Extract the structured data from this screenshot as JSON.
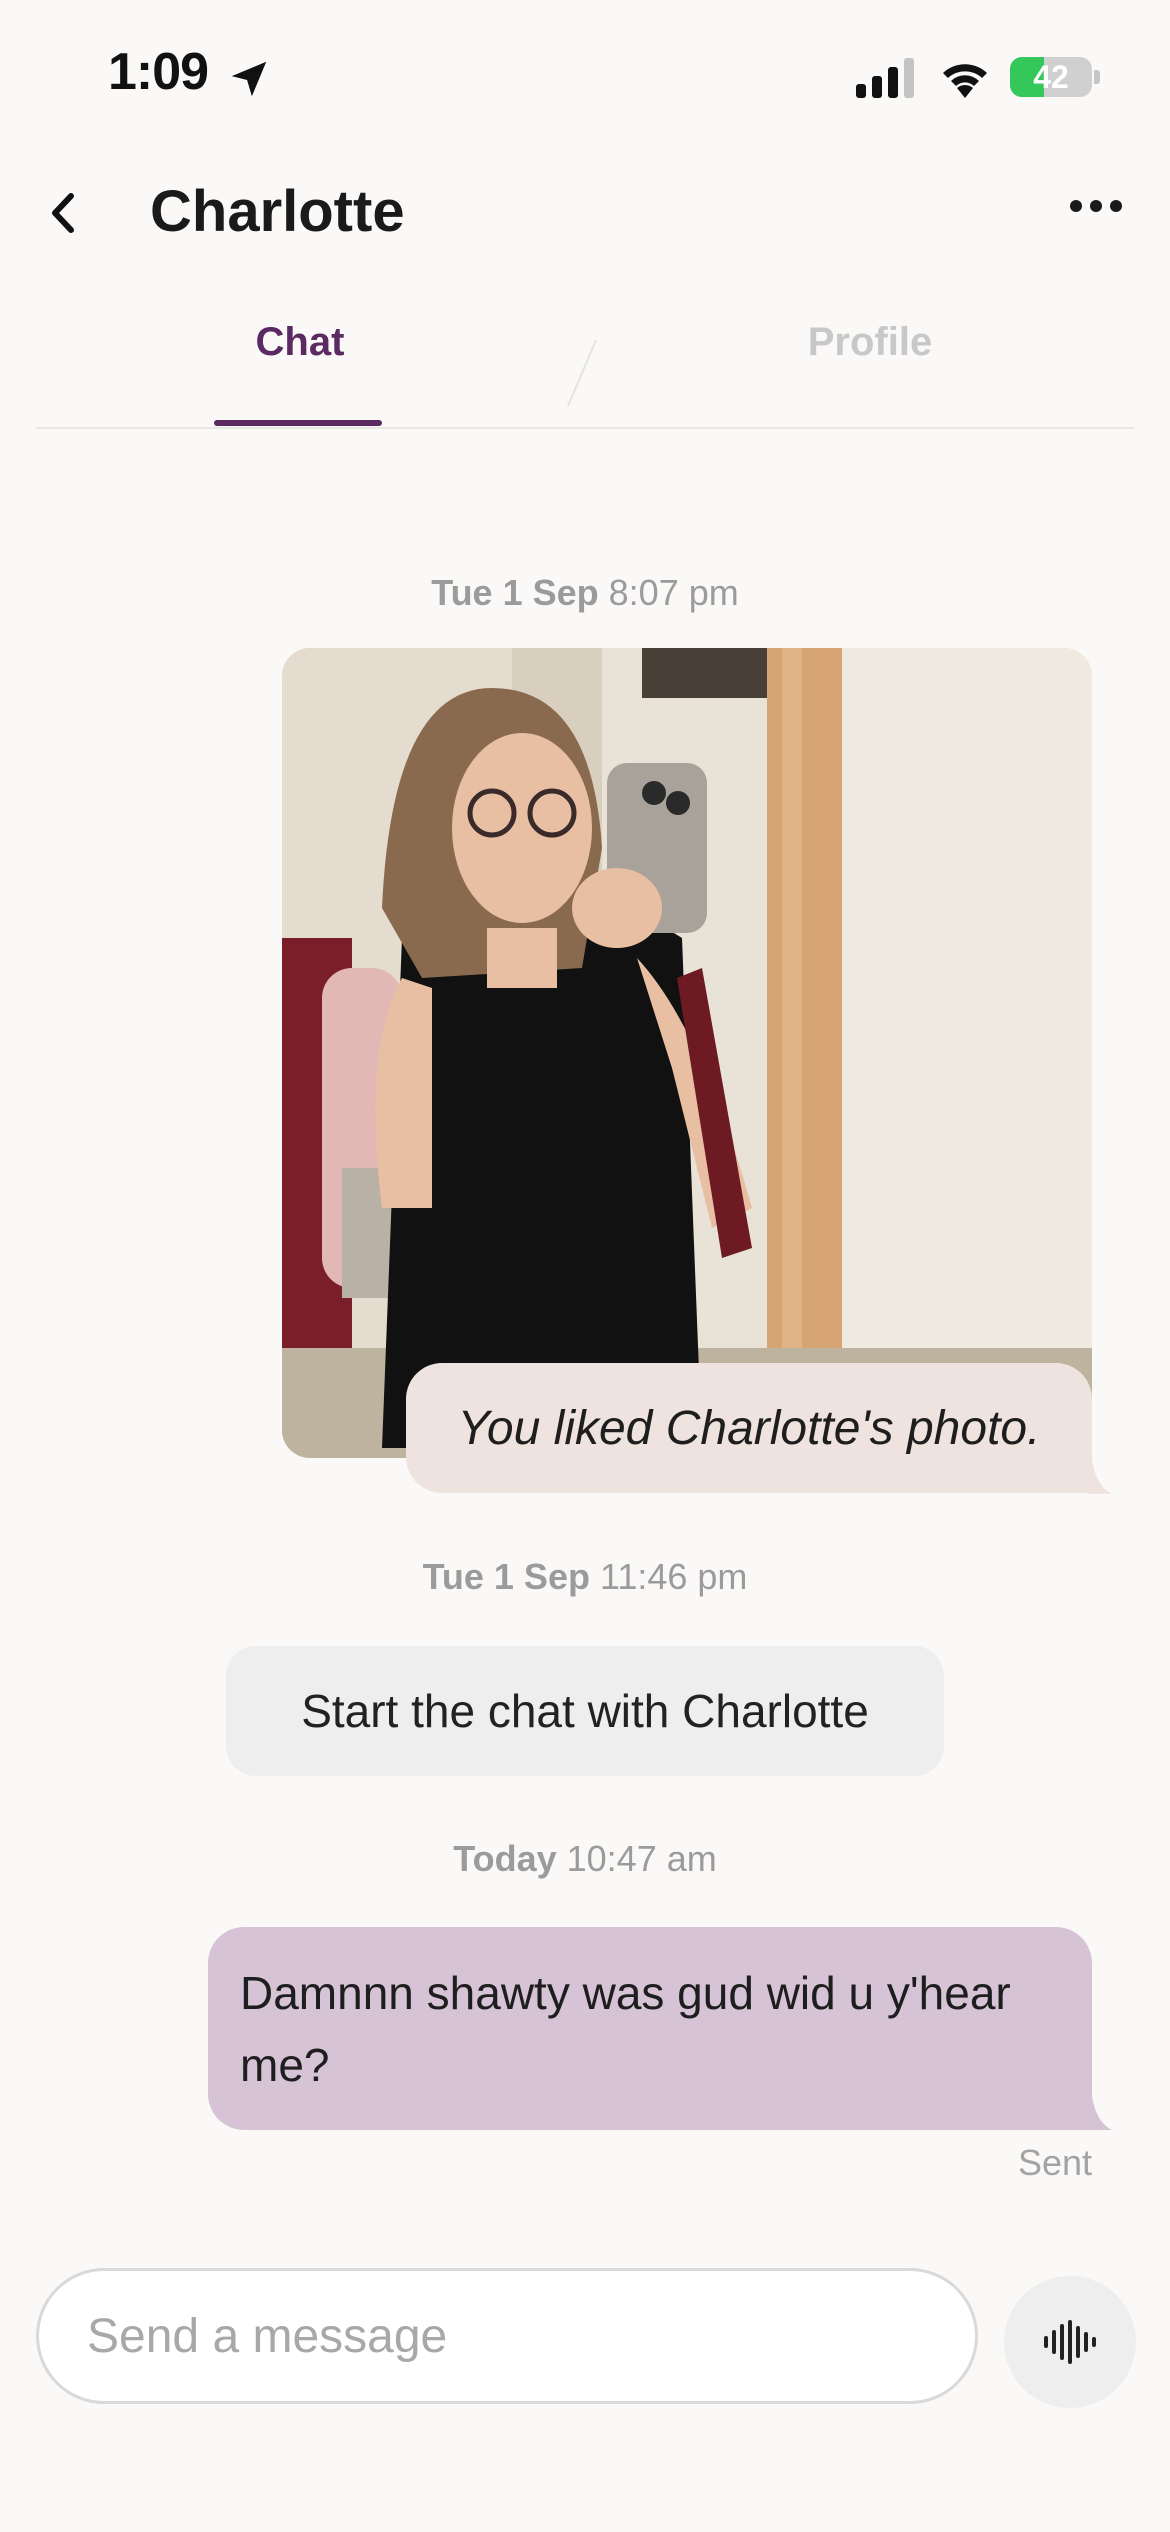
{
  "status_bar": {
    "time": "1:09",
    "battery_text": "42",
    "battery_level": 0.42,
    "icons": [
      "location-arrow-icon",
      "cellular-signal-icon",
      "wifi-icon",
      "battery-charging-icon"
    ]
  },
  "header": {
    "title": "Charlotte",
    "back_icon": "chevron-left-icon",
    "more_icon": "more-horizontal-icon"
  },
  "tabs": [
    {
      "label": "Chat",
      "active": true
    },
    {
      "label": "Profile",
      "active": false
    }
  ],
  "messages": {
    "stamp1": {
      "day": "Tue 1 Sep",
      "time": "8:07 pm"
    },
    "liked_text": "You liked Charlotte's photo.",
    "stamp2": {
      "day": "Tue 1 Sep",
      "time": "11:46 pm"
    },
    "system_text": "Start the chat with Charlotte",
    "stamp3": {
      "day": "Today",
      "time": "10:47 am"
    },
    "my_message": "Damnnn shawty was gud wid u y'hear me?",
    "status": "Sent"
  },
  "composer": {
    "placeholder": "Send a message",
    "voice_icon": "audio-waveform-icon"
  },
  "colors": {
    "accent": "#5c2a63",
    "liked_bubble": "#efe3df",
    "my_bubble": "#d6c4d6",
    "system_bubble": "#eeeeee",
    "background": "#fbf9f7"
  }
}
